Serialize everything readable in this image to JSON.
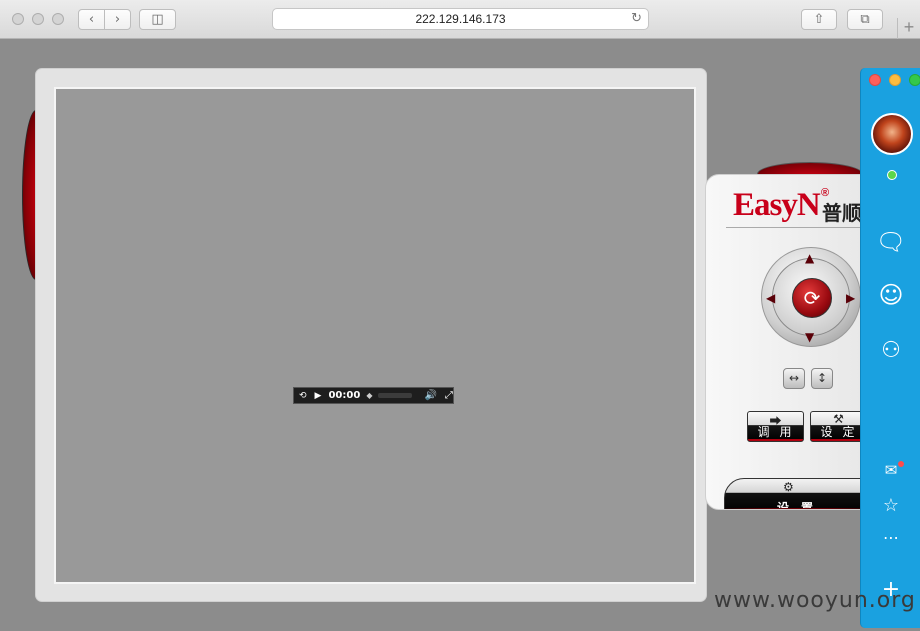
{
  "browser": {
    "address": "222.129.146.173",
    "back_icon": "chevron-left-icon",
    "forward_icon": "chevron-right-icon",
    "sidebar_icon": "sidebar-icon",
    "reload_icon": "reload-icon",
    "share_icon": "share-icon",
    "tabs_icon": "tabs-icon",
    "new_tab_icon": "plus-icon"
  },
  "player": {
    "time": "00:00",
    "replay_icon": "replay-30-icon",
    "play_icon": "play-icon",
    "volume_icon": "volume-icon",
    "fullscreen_icon": "fullscreen-icon"
  },
  "ptz": {
    "brand": "EasyN",
    "brand_reg": "®",
    "brand_cn": "普顺",
    "center_icon": "rotate-icon",
    "h_mirror_icon": "horizontal-flip-icon",
    "v_flip_icon": "vertical-flip-icon",
    "recall_label": "调用",
    "set_label": "设定",
    "settings_label": "设置",
    "colors": {
      "accent": "#c8001a"
    }
  },
  "chat": {
    "sidebar_color": "#1aa1e0",
    "icons": [
      "message-icon",
      "contact-icon",
      "group-icon",
      "mail-icon",
      "star-icon",
      "more-icon",
      "add-icon"
    ]
  },
  "watermark": "www.wooyun.org"
}
